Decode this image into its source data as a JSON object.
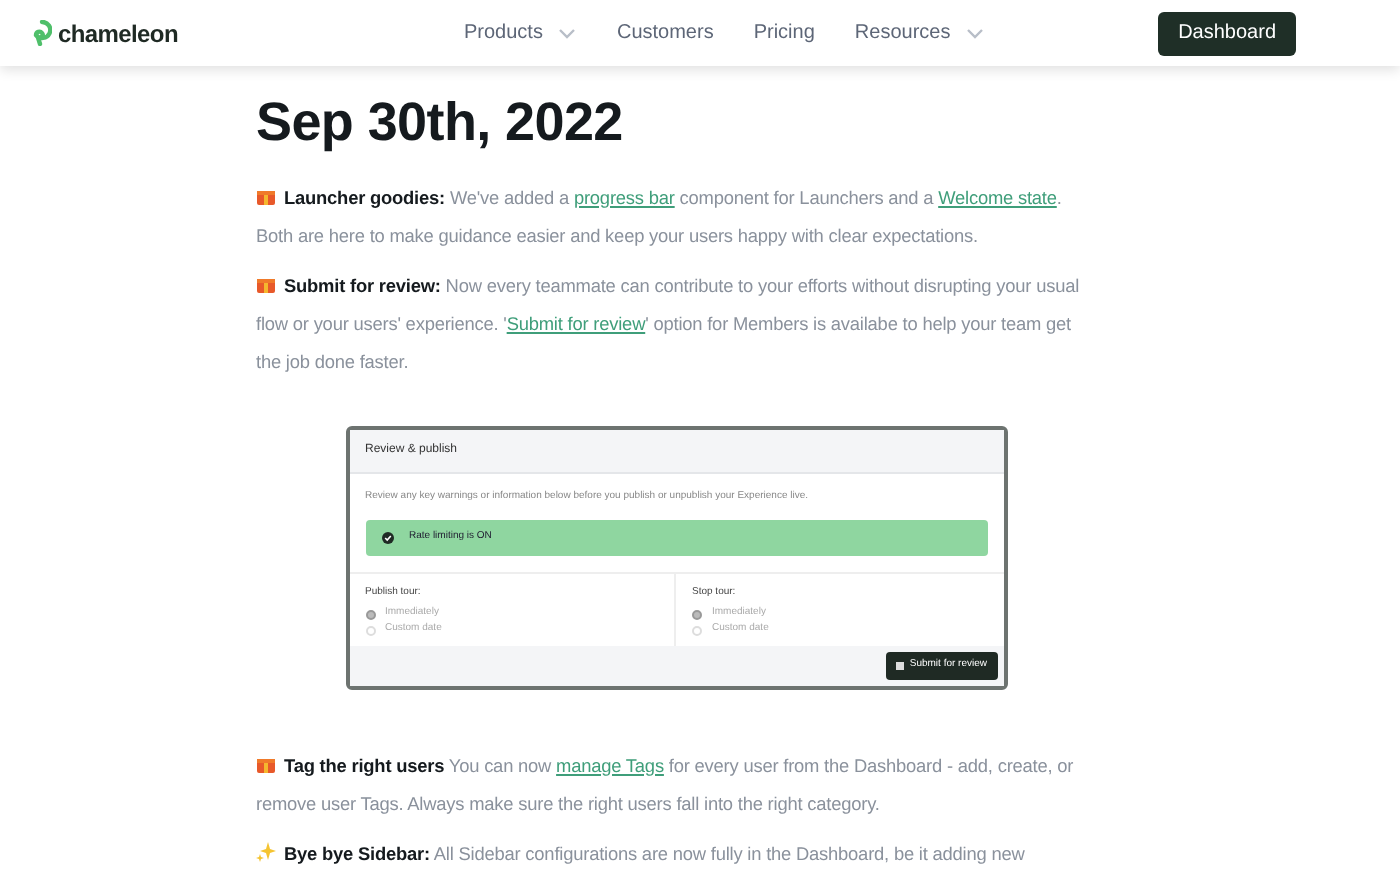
{
  "nav": {
    "logo": "chameleon",
    "links": [
      {
        "label": "Products",
        "dropdown": true
      },
      {
        "label": "Customers",
        "dropdown": false
      },
      {
        "label": "Pricing",
        "dropdown": false
      },
      {
        "label": "Resources",
        "dropdown": true
      }
    ],
    "cta": "Dashboard"
  },
  "title": "Sep 30th, 2022",
  "sections": [
    {
      "kind": "gift",
      "parts": [
        {
          "kind": "bold",
          "text": "Launcher goodies:"
        },
        {
          "kind": "text",
          "text": " We've added a "
        },
        {
          "kind": "link",
          "text": "progress bar"
        },
        {
          "kind": "text",
          "text": " component for Launchers and a "
        },
        {
          "kind": "link",
          "text": "Welcome state"
        },
        {
          "kind": "text",
          "text": ". Both are here to make guidance easier and keep your users happy with clear expectations."
        }
      ]
    },
    {
      "kind": "gift",
      "parts": [
        {
          "kind": "bold",
          "text": "Submit for review:"
        },
        {
          "kind": "text",
          "text": " Now every teammate can contribute to your efforts without disrupting your usual flow or your users' experience. '"
        },
        {
          "kind": "link",
          "text": "Submit for review"
        },
        {
          "kind": "text",
          "text": "' option for Members is availabe to help your team get the job done faster."
        }
      ],
      "screenshot": {
        "title": "Review & publish",
        "description": "Review any key warnings or information below before you publish or unpublish your Experience live.",
        "alert": "Rate limiting is ON",
        "columns": [
          {
            "label": "Publish tour:",
            "options": [
              {
                "label": "Immediately",
                "selected": true
              },
              {
                "label": "Custom date",
                "selected": false
              }
            ]
          },
          {
            "label": "Stop tour:",
            "options": [
              {
                "label": "Immediately",
                "selected": true
              },
              {
                "label": "Custom date",
                "selected": false
              }
            ]
          }
        ],
        "button": "Submit for review"
      }
    },
    {
      "kind": "gift",
      "parts": [
        {
          "kind": "bold",
          "text": "Tag the right users"
        },
        {
          "kind": "text",
          "text": " You can now "
        },
        {
          "kind": "link",
          "text": "manage Tags"
        },
        {
          "kind": "text",
          "text": " for every user from the Dashboard - add, create, or remove user Tags. Always make sure the right users fall into the right category."
        }
      ]
    },
    {
      "kind": "sparkles",
      "parts": [
        {
          "kind": "bold",
          "text": "Bye bye Sidebar:"
        },
        {
          "kind": "text",
          "text": " All Sidebar configurations are now fully in the Dashboard, be it adding new"
        }
      ]
    }
  ]
}
